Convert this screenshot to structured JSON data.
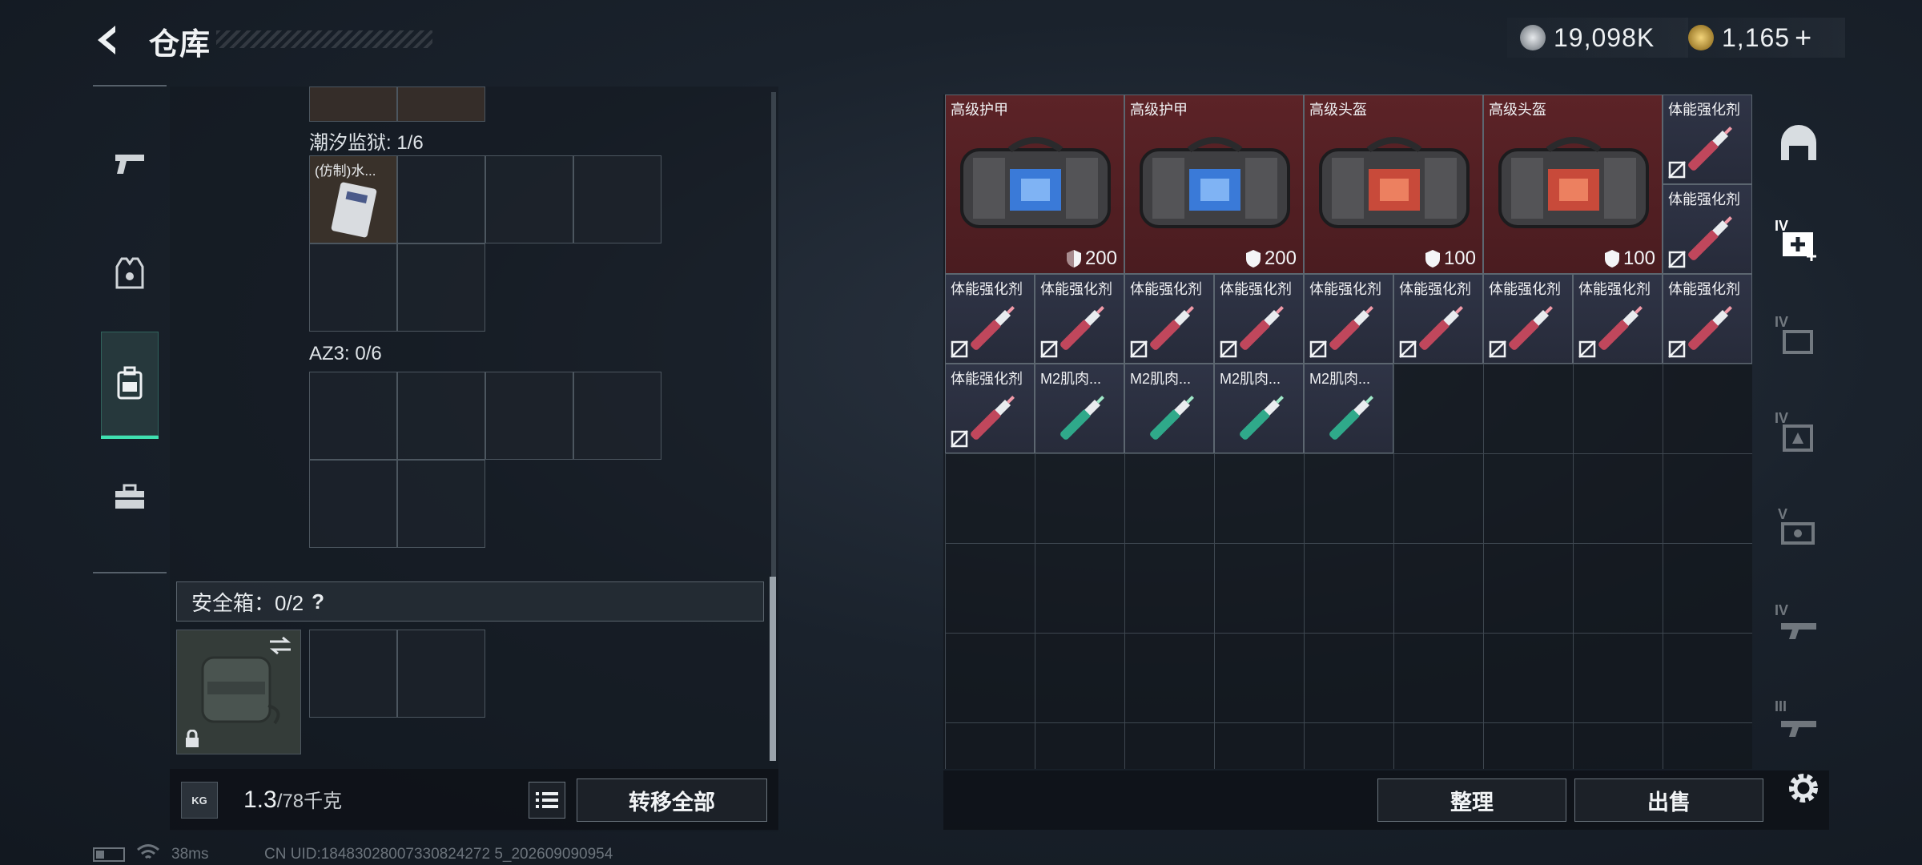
{
  "header": {
    "title": "仓库",
    "currency_silver": "19,098K",
    "currency_gold": "1,165",
    "currency_add": "+"
  },
  "nav": {
    "items": [
      {
        "name": "weapons",
        "icon": "pistol-icon"
      },
      {
        "name": "armor",
        "icon": "armor-vest-icon"
      },
      {
        "name": "backpack",
        "icon": "backpack-icon",
        "active": true
      },
      {
        "name": "toolbox",
        "icon": "toolbox-icon"
      }
    ]
  },
  "containers": {
    "prison_label": "潮汐监狱: 1/6",
    "prison_item": "(仿制)水...",
    "az3_label": "AZ3: 0/6",
    "safe_label": "安全箱：0/2",
    "safe_help": "?"
  },
  "bottom_left": {
    "weight_value": "1.3",
    "weight_max": "/78千克",
    "weight_icon_text": "KG",
    "transfer_all": "转移全部"
  },
  "stash": {
    "bags": [
      {
        "name": "高级护甲",
        "value": "200",
        "color": "blue"
      },
      {
        "name": "高级护甲",
        "value": "200",
        "color": "blue"
      },
      {
        "name": "高级头盔",
        "value": "100",
        "color": "red"
      },
      {
        "name": "高级头盔",
        "value": "100",
        "color": "red"
      }
    ],
    "small_items": [
      "体能强化剂",
      "体能强化剂",
      "体能强化剂",
      "体能强化剂",
      "体能强化剂",
      "体能强化剂",
      "体能强化剂",
      "体能强化剂",
      "体能强化剂",
      "体能强化剂",
      "体能强化剂",
      "体能强化剂",
      "M2肌肉...",
      "M2肌肉...",
      "M2肌肉...",
      "M2肌肉..."
    ]
  },
  "bottom_right": {
    "organize": "整理",
    "sell": "出售"
  },
  "side_tabs": [
    "IV",
    "IV",
    "IV",
    "V",
    "IV",
    "III"
  ],
  "footer": {
    "ping": "38ms",
    "uid": "CN UID:18483028007330824272 5_202609090954"
  },
  "colors": {
    "accent": "#3fe0b0",
    "red_cell": "#5c2327",
    "blue_cell": "#2f3446"
  }
}
